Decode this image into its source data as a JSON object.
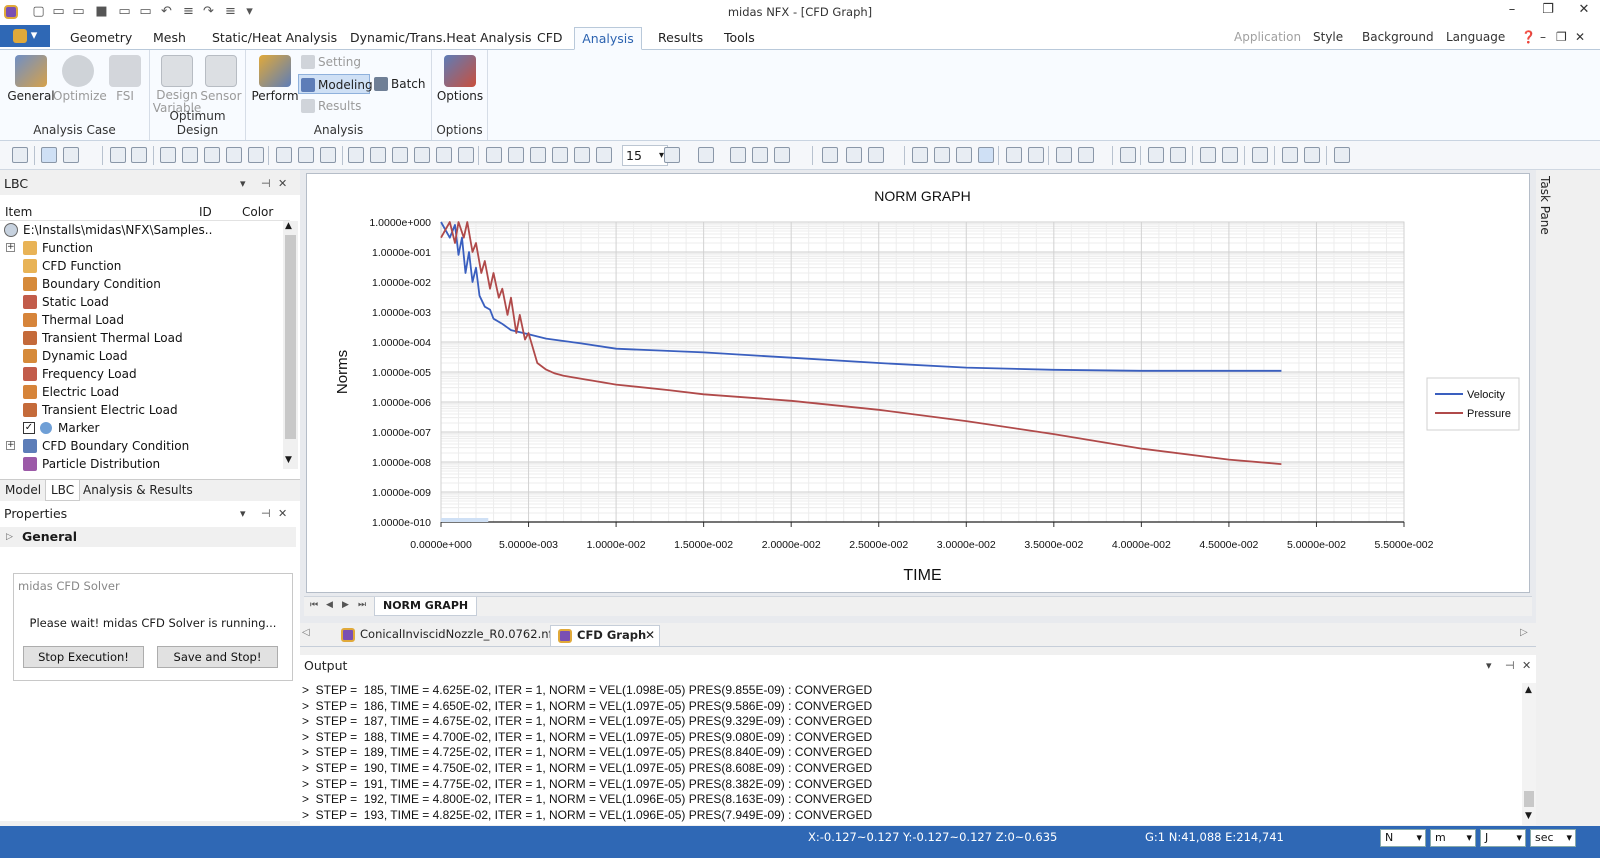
{
  "window": {
    "title": "midas NFX - [CFD Graph]"
  },
  "menu": {
    "app_button": "▾",
    "tabs": [
      "Geometry",
      "Mesh",
      "Static/Heat Analysis",
      "Dynamic/Trans.Heat Analysis",
      "CFD",
      "Analysis",
      "Results",
      "Tools"
    ],
    "active_tab": "Analysis",
    "right": [
      "Application",
      "Style",
      "Background",
      "Language"
    ]
  },
  "ribbon": {
    "analysis_case": {
      "label": "Analysis Case",
      "general": "General",
      "optimize": "Optimize",
      "fsi": "FSI"
    },
    "optimum_design": {
      "label": "Optimum Design",
      "design_variable": "Design\nVariable",
      "sensor": "Sensor"
    },
    "analysis": {
      "label": "Analysis",
      "perform": "Perform",
      "setting": "Setting",
      "modeling": "Modeling",
      "results": "Results",
      "batch": "Batch"
    },
    "options": {
      "label": "Options",
      "options": "Options"
    }
  },
  "toolbar": {
    "zoom_value": "15"
  },
  "lbc_panel": {
    "title": "LBC",
    "columns": [
      "Item",
      "ID",
      "Color"
    ],
    "root": "E:\\Installs\\midas\\NFX\\Samples..",
    "items": [
      "Function",
      "CFD Function",
      "Boundary Condition",
      "Static Load",
      "Thermal Load",
      "Transient Thermal Load",
      "Dynamic Load",
      "Frequency Load",
      "Electric Load",
      "Transient Electric Load",
      "Marker",
      "CFD Boundary Condition",
      "Particle Distribution"
    ]
  },
  "panel_tabs": [
    "Model",
    "LBC",
    "Analysis & Results"
  ],
  "properties": {
    "title": "Properties",
    "section": "General"
  },
  "solver": {
    "title": "midas CFD Solver",
    "message": "Please wait! midas CFD Solver is running...",
    "stop": "Stop Execution!",
    "save_stop": "Save and Stop!"
  },
  "graph_tab": "NORM GRAPH",
  "doc_tabs": [
    "ConicalInviscidNozzle_R0.0762.nfx",
    "CFD Graph"
  ],
  "output": {
    "title": "Output",
    "lines": [
      ">  STEP =  185, TIME = 4.625E-02, ITER = 1, NORM = VEL(1.098E-05) PRES(9.855E-09) : CONVERGED",
      ">  STEP =  186, TIME = 4.650E-02, ITER = 1, NORM = VEL(1.097E-05) PRES(9.586E-09) : CONVERGED",
      ">  STEP =  187, TIME = 4.675E-02, ITER = 1, NORM = VEL(1.097E-05) PRES(9.329E-09) : CONVERGED",
      ">  STEP =  188, TIME = 4.700E-02, ITER = 1, NORM = VEL(1.097E-05) PRES(9.080E-09) : CONVERGED",
      ">  STEP =  189, TIME = 4.725E-02, ITER = 1, NORM = VEL(1.097E-05) PRES(8.840E-09) : CONVERGED",
      ">  STEP =  190, TIME = 4.750E-02, ITER = 1, NORM = VEL(1.097E-05) PRES(8.608E-09) : CONVERGED",
      ">  STEP =  191, TIME = 4.775E-02, ITER = 1, NORM = VEL(1.097E-05) PRES(8.382E-09) : CONVERGED",
      ">  STEP =  192, TIME = 4.800E-02, ITER = 1, NORM = VEL(1.096E-05) PRES(8.163E-09) : CONVERGED",
      ">  STEP =  193, TIME = 4.825E-02, ITER = 1, NORM = VEL(1.096E-05) PRES(7.949E-09) : CONVERGED"
    ]
  },
  "task_pane": "Task Pane",
  "status": {
    "coords": "X:-0.127~0.127 Y:-0.127~0.127 Z:0~0.635",
    "counts": "G:1  N:41,088  E:214,741",
    "units": [
      "N",
      "m",
      "J",
      "sec"
    ]
  },
  "colors": {
    "velocity": "#3a5fbf",
    "pressure": "#b04a4a",
    "accent": "#2f68b5"
  },
  "chart_data": {
    "type": "line",
    "title": "NORM GRAPH",
    "xlabel": "TIME",
    "ylabel": "Norms",
    "yscale": "log",
    "xlim": [
      0,
      0.055
    ],
    "ylim": [
      1e-10,
      1
    ],
    "x_tick_labels": [
      "0.0000e+000",
      "5.0000e-003",
      "1.0000e-002",
      "1.5000e-002",
      "2.0000e-002",
      "2.5000e-002",
      "3.0000e-002",
      "3.5000e-002",
      "4.0000e-002",
      "4.5000e-002",
      "5.0000e-002",
      "5.5000e-002"
    ],
    "y_tick_labels": [
      "1.0000e+000",
      "1.0000e-001",
      "1.0000e-002",
      "1.0000e-003",
      "1.0000e-004",
      "1.0000e-005",
      "1.0000e-006",
      "1.0000e-007",
      "1.0000e-008",
      "1.0000e-009",
      "1.0000e-010"
    ],
    "legend_position": "right",
    "grid": true,
    "series": [
      {
        "name": "Velocity",
        "color": "#3a5fbf",
        "x": [
          0,
          0.0005,
          0.0008,
          0.001,
          0.0012,
          0.0014,
          0.0016,
          0.0018,
          0.002,
          0.0022,
          0.0025,
          0.0028,
          0.003,
          0.0035,
          0.004,
          0.005,
          0.006,
          0.008,
          0.01,
          0.015,
          0.02,
          0.025,
          0.03,
          0.035,
          0.04,
          0.045,
          0.048
        ],
        "y": [
          1.0,
          0.3,
          0.8,
          0.08,
          0.3,
          0.02,
          0.1,
          0.01,
          0.03,
          0.0035,
          0.0015,
          0.0012,
          0.0006,
          0.0004,
          0.00025,
          0.00018,
          0.00013,
          9e-05,
          6e-05,
          4.5e-05,
          3e-05,
          2e-05,
          1.4e-05,
          1.18e-05,
          1.1e-05,
          1.1e-05,
          1.1e-05
        ]
      },
      {
        "name": "Pressure",
        "color": "#b04a4a",
        "x": [
          0,
          0.0005,
          0.0008,
          0.001,
          0.0013,
          0.0015,
          0.0018,
          0.002,
          0.0023,
          0.0025,
          0.0028,
          0.003,
          0.0033,
          0.0035,
          0.0038,
          0.004,
          0.0043,
          0.0045,
          0.0048,
          0.005,
          0.0055,
          0.006,
          0.0065,
          0.007,
          0.008,
          0.01,
          0.013,
          0.015,
          0.02,
          0.025,
          0.03,
          0.035,
          0.04,
          0.045,
          0.048
        ],
        "y": [
          0.3,
          1.0,
          0.2,
          1.0,
          0.3,
          1.0,
          0.1,
          0.2,
          0.02,
          0.05,
          0.006,
          0.02,
          0.003,
          0.006,
          0.0008,
          0.003,
          0.0002,
          0.0008,
          0.00012,
          0.0002,
          2e-05,
          1.2e-05,
          9e-06,
          7.5e-06,
          6e-06,
          3.8e-06,
          2.5e-06,
          1.8e-06,
          1.1e-06,
          5.5e-07,
          2.3e-07,
          8.5e-08,
          2.8e-08,
          1.2e-08,
          8.5e-09
        ]
      }
    ]
  }
}
